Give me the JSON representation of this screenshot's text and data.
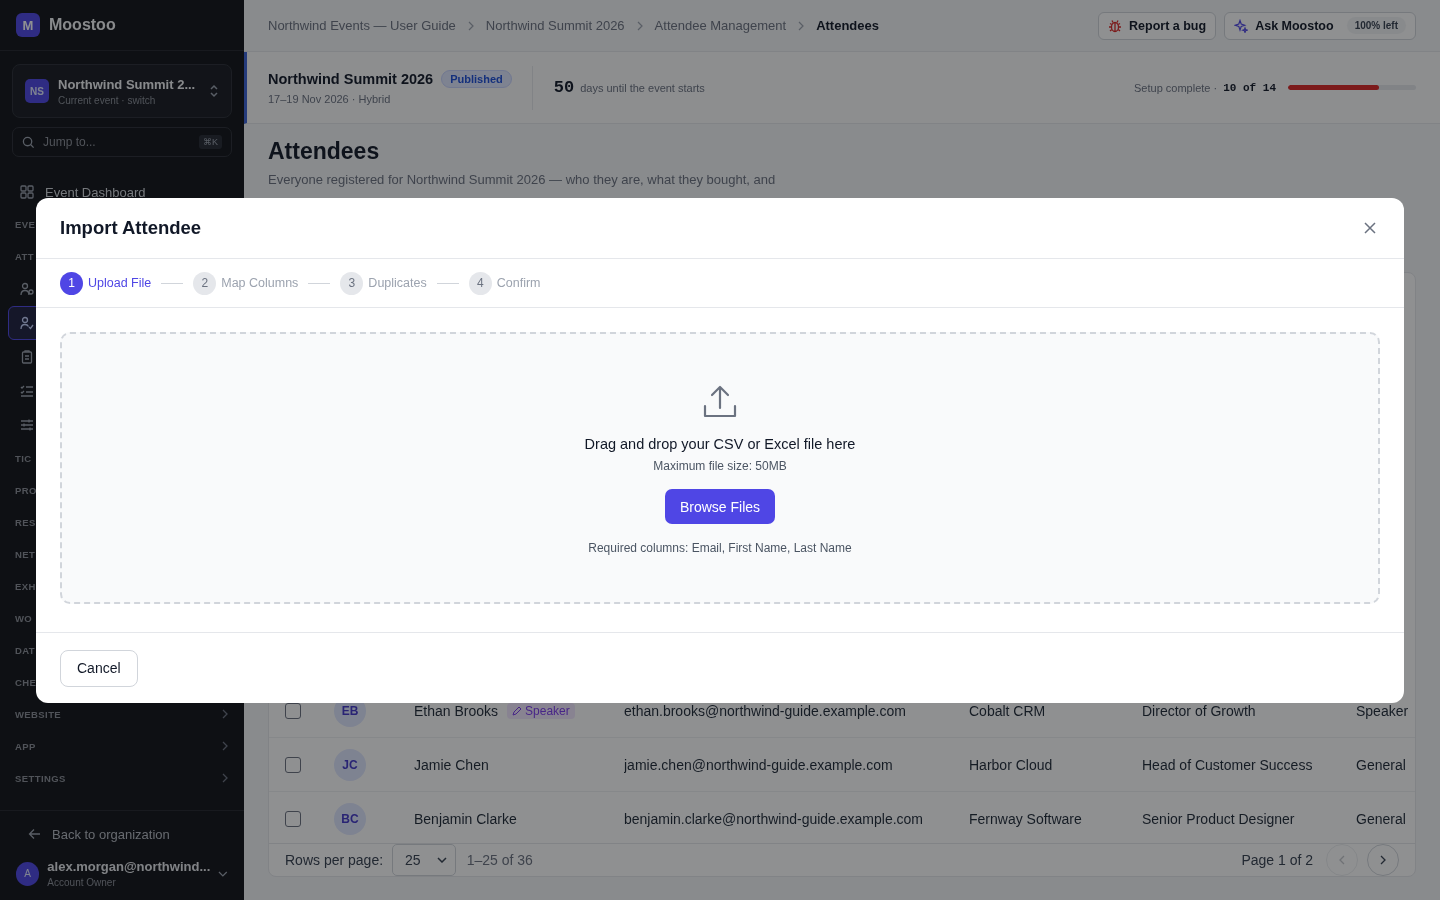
{
  "sidebar": {
    "logo": {
      "letter": "M",
      "name": "Moostoo"
    },
    "event_switcher": {
      "initials": "NS",
      "name": "Northwind Summit 2...",
      "caption": "Current event · switch"
    },
    "search": {
      "placeholder": "Jump to...",
      "shortcut": "⌘K"
    },
    "nav": [
      {
        "kind": "item",
        "label": "Event Dashboard"
      },
      {
        "kind": "section",
        "label": "EVE"
      },
      {
        "kind": "section",
        "label": "ATT"
      },
      {
        "kind": "icon",
        "selected": false
      },
      {
        "kind": "icon",
        "selected": true
      },
      {
        "kind": "icon",
        "selected": false
      },
      {
        "kind": "icon",
        "selected": false
      },
      {
        "kind": "icon",
        "selected": false
      },
      {
        "kind": "section",
        "label": "TIC"
      },
      {
        "kind": "section",
        "label": "PRO"
      },
      {
        "kind": "section",
        "label": "RES"
      },
      {
        "kind": "section",
        "label": "NET"
      },
      {
        "kind": "section",
        "label": "EXH"
      },
      {
        "kind": "section",
        "label": "WO"
      },
      {
        "kind": "section",
        "label": "DAT"
      },
      {
        "kind": "section",
        "label": "CHE"
      },
      {
        "kind": "section",
        "label": "WEBSITE",
        "chevron": true
      },
      {
        "kind": "section",
        "label": "APP",
        "chevron": true
      },
      {
        "kind": "section",
        "label": "SETTINGS",
        "chevron": true
      }
    ],
    "back_link": "Back to organization",
    "user": {
      "initial": "A",
      "email": "alex.morgan@northwind...",
      "role": "Account Owner"
    }
  },
  "breadcrumbs": [
    {
      "label": "Northwind Events — User Guide",
      "current": false
    },
    {
      "label": "Northwind Summit 2026",
      "current": false
    },
    {
      "label": "Attendee Management",
      "current": false
    },
    {
      "label": "Attendees",
      "current": true
    }
  ],
  "actions": {
    "report_bug": "Report a bug",
    "ask": {
      "label": "Ask Moostoo",
      "quota": "100% left"
    }
  },
  "event_bar": {
    "name": "Northwind Summit 2026",
    "status": "Published",
    "dates": "17–19 Nov 2026 · Hybrid",
    "countdown": {
      "number": "50",
      "text": "days until the event starts"
    },
    "setup": {
      "label": "Setup complete ·",
      "count": "10 of 14",
      "level": 0.71
    }
  },
  "page": {
    "title": "Attendees",
    "description": "Everyone registered for Northwind Summit 2026 — who they are, what they bought, and"
  },
  "table": {
    "rows": [
      {
        "checked": false,
        "initials": "EB",
        "name": "Ethan Brooks",
        "tag": "Speaker",
        "email": "ethan.brooks@northwind-guide.example.com",
        "company": "Cobalt CRM",
        "job_title": "Director of Growth",
        "ticket": "Speaker"
      },
      {
        "checked": false,
        "initials": "JC",
        "name": "Jamie Chen",
        "email": "jamie.chen@northwind-guide.example.com",
        "company": "Harbor Cloud",
        "job_title": "Head of Customer Success",
        "ticket": "General"
      },
      {
        "checked": false,
        "initials": "BC",
        "name": "Benjamin Clarke",
        "email": "benjamin.clarke@northwind-guide.example.com",
        "company": "Fernway Software",
        "job_title": "Senior Product Designer",
        "ticket": "General"
      }
    ],
    "footer": {
      "rows_per_page_label": "Rows per page:",
      "rows_per_page": "25",
      "range": "1–25 of 36",
      "page": "Page 1 of 2"
    }
  },
  "modal": {
    "title": "Import Attendee",
    "steps": [
      {
        "number": "1",
        "label": "Upload File",
        "selected": true
      },
      {
        "number": "2",
        "label": "Map Columns",
        "selected": false
      },
      {
        "number": "3",
        "label": "Duplicates",
        "selected": false
      },
      {
        "number": "4",
        "label": "Confirm",
        "selected": false
      }
    ],
    "dropzone": {
      "heading": "Drag and drop your CSV or Excel file here",
      "max_size": "Maximum file size: 50MB",
      "button": "Browse Files",
      "required": "Required columns: Email, First Name, Last Name"
    },
    "cancel": "Cancel"
  }
}
